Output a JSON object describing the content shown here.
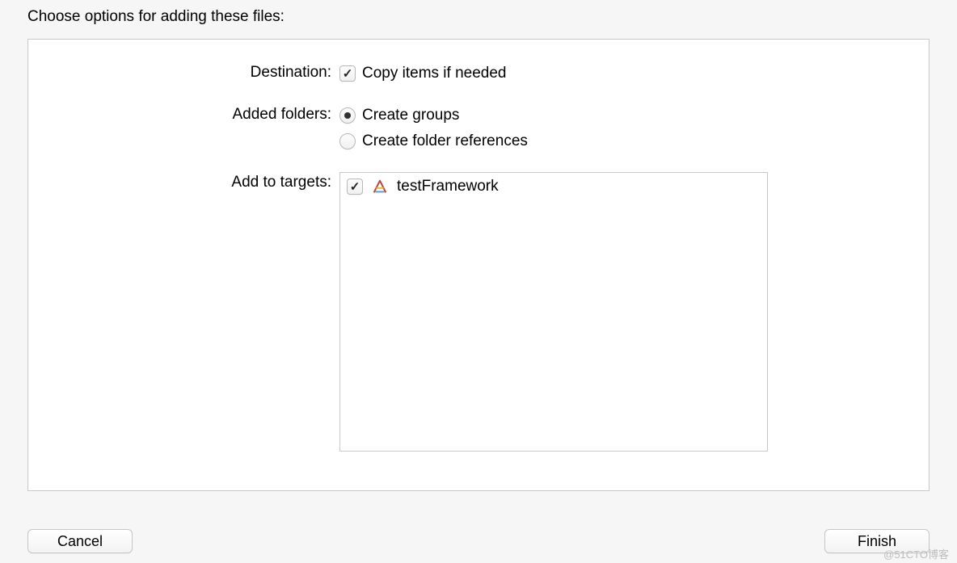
{
  "heading": "Choose options for adding these files:",
  "labels": {
    "destination": "Destination:",
    "added_folders": "Added folders:",
    "add_to_targets": "Add to targets:"
  },
  "options": {
    "copy_items": "Copy items if needed",
    "create_groups": "Create groups",
    "create_folder_refs": "Create folder references"
  },
  "targets": {
    "items": [
      {
        "name": "testFramework",
        "checked": true
      }
    ]
  },
  "buttons": {
    "cancel": "Cancel",
    "finish": "Finish"
  },
  "watermark": "@51CTO博客"
}
